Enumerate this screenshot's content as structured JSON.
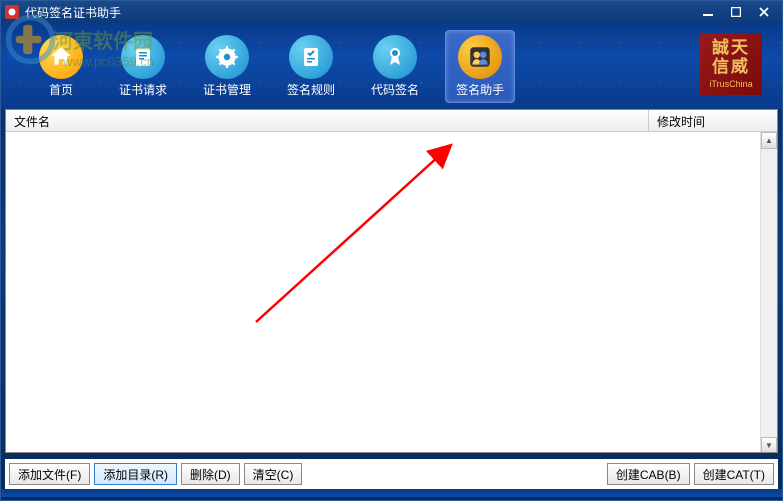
{
  "titlebar": {
    "title": "代码签名证书助手"
  },
  "watermark": {
    "text": "河東软件园",
    "url": "www.pc0359.cn"
  },
  "toolbar": {
    "items": [
      {
        "label": "首页",
        "icon": "home"
      },
      {
        "label": "证书请求",
        "icon": "cert-req"
      },
      {
        "label": "证书管理",
        "icon": "cert-mgr"
      },
      {
        "label": "签名规则",
        "icon": "sign-rule"
      },
      {
        "label": "代码签名",
        "icon": "code-sign"
      },
      {
        "label": "签名助手",
        "icon": "sign-helper"
      }
    ]
  },
  "brand": {
    "line1": "誠天",
    "line2": "信威",
    "sub": "iTrusChina"
  },
  "list": {
    "col_name": "文件名",
    "col_time": "修改时间"
  },
  "buttons": {
    "add_file": "添加文件(F)",
    "add_dir": "添加目录(R)",
    "delete": "删除(D)",
    "clear": "清空(C)",
    "create_cab": "创建CAB(B)",
    "create_cat": "创建CAT(T)"
  }
}
